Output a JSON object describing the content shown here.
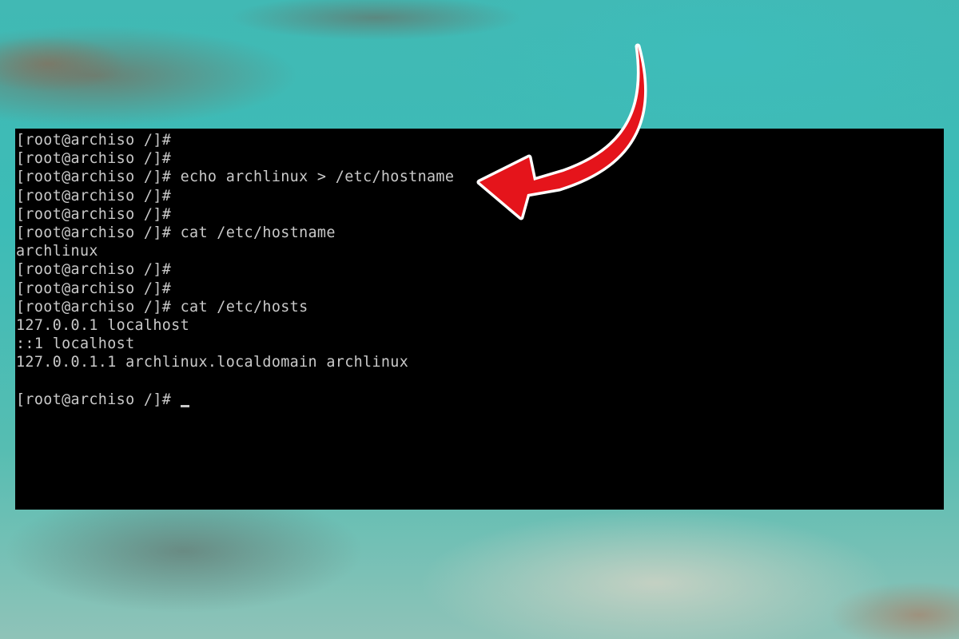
{
  "terminal": {
    "lines": [
      "[root@archiso /]#",
      "[root@archiso /]#",
      "[root@archiso /]# echo archlinux > /etc/hostname",
      "[root@archiso /]#",
      "[root@archiso /]#",
      "[root@archiso /]# cat /etc/hostname",
      "archlinux",
      "[root@archiso /]#",
      "[root@archiso /]#",
      "[root@archiso /]# cat /etc/hosts",
      "127.0.0.1 localhost",
      "::1 localhost",
      "127.0.0.1.1 archlinux.localdomain archlinux",
      "",
      "[root@archiso /]# "
    ],
    "text_color": "#c9c9c9",
    "background_color": "#000000"
  },
  "annotation": {
    "arrow_color": "#e5141b",
    "arrow_outline_color": "#ffffff",
    "icon": "curved-arrow-icon"
  }
}
